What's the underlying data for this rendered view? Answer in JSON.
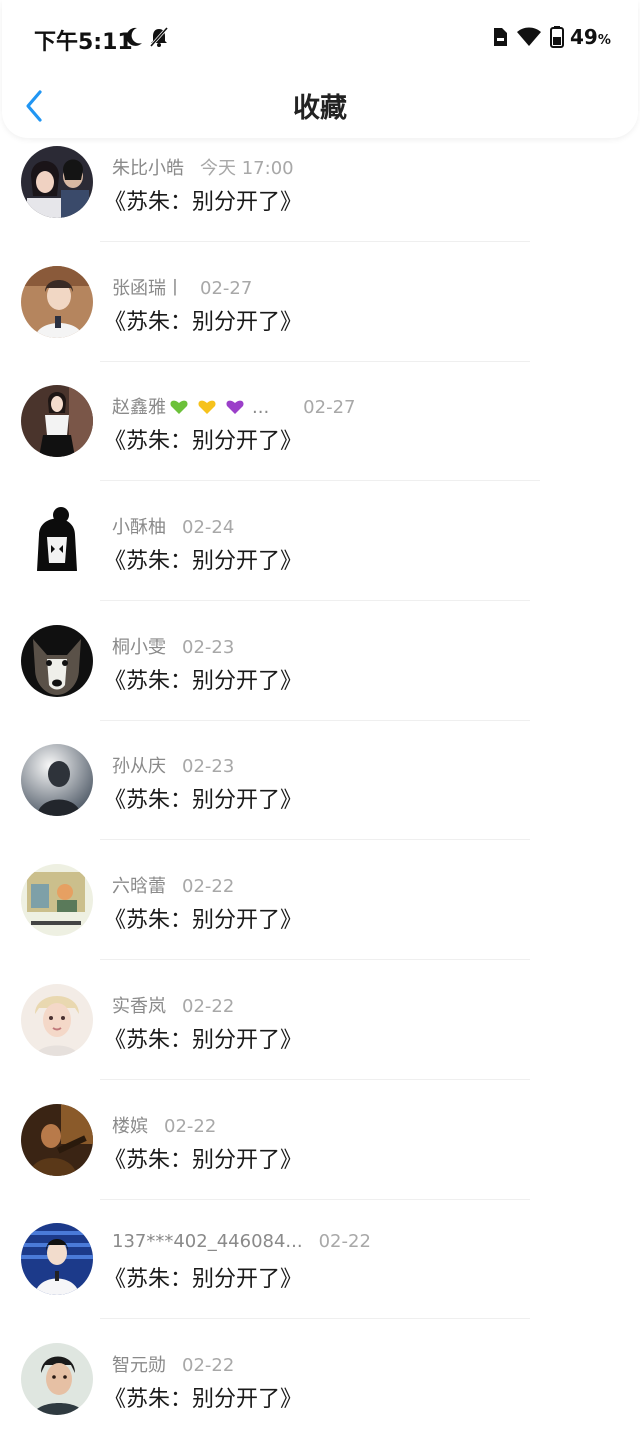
{
  "status_bar": {
    "time": "下午5:11",
    "battery_percent": "49",
    "battery_unit": "%",
    "icons": [
      "moon-icon",
      "bell-off-icon",
      "sim-card-icon",
      "wifi-icon",
      "battery-icon"
    ]
  },
  "header": {
    "title": "收藏",
    "back_icon": "chevron-left-icon",
    "accent": "#2196F3"
  },
  "items": [
    {
      "name": "朱比小皓",
      "date": "今天 17:00",
      "text": "《苏朱：别分开了》"
    },
    {
      "name": "张函瑞丨",
      "date": "02-27",
      "text": "《苏朱：别分开了》"
    },
    {
      "name": "赵鑫雅",
      "name_suffix": "...",
      "hearts": [
        "green-heart-icon",
        "yellow-heart-icon",
        "purple-heart-icon"
      ],
      "date": "02-27",
      "text": "《苏朱：别分开了》"
    },
    {
      "name": "小酥柚",
      "date": "02-24",
      "text": "《苏朱：别分开了》"
    },
    {
      "name": "桐小雯",
      "date": "02-23",
      "text": "《苏朱：别分开了》"
    },
    {
      "name": "孙从庆",
      "date": "02-23",
      "text": "《苏朱：别分开了》"
    },
    {
      "name": "六晗蕾",
      "date": "02-22",
      "text": "《苏朱：别分开了》"
    },
    {
      "name": "实香岚",
      "date": "02-22",
      "text": "《苏朱：别分开了》"
    },
    {
      "name": "楼嫔",
      "date": "02-22",
      "text": "《苏朱：别分开了》"
    },
    {
      "name": "137***402_446084...",
      "date": "02-22",
      "text": "《苏朱：别分开了》"
    },
    {
      "name": "智元勋",
      "date": "02-22",
      "text": "《苏朱：别分开了》"
    }
  ]
}
